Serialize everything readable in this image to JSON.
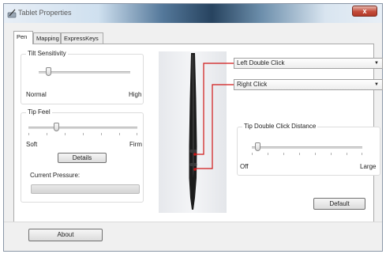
{
  "window": {
    "title": "Tablet Properties",
    "close_label": "x"
  },
  "tabs": [
    {
      "label": "Pen",
      "active": true
    },
    {
      "label": "Mapping",
      "active": false
    },
    {
      "label": "ExpressKeys",
      "active": false
    }
  ],
  "tilt": {
    "title": "Tilt Sensitivity",
    "min_label": "Normal",
    "max_label": "High",
    "value": 0.1
  },
  "tip_feel": {
    "title": "Tip Feel",
    "min_label": "Soft",
    "max_label": "Firm",
    "value": 0.25,
    "details_label": "Details",
    "pressure_label": "Current Pressure:",
    "pressure_value": 0
  },
  "pen_buttons": {
    "upper": {
      "selected": "Left Double Click"
    },
    "lower": {
      "selected": "Right Click"
    }
  },
  "tip_double_click": {
    "title": "Tip Double Click Distance",
    "min_label": "Off",
    "max_label": "Large",
    "value": 0.05
  },
  "default_label": "Default",
  "about_label": "About",
  "colors": {
    "callout": "#d01818",
    "selection": "#3399ff"
  }
}
